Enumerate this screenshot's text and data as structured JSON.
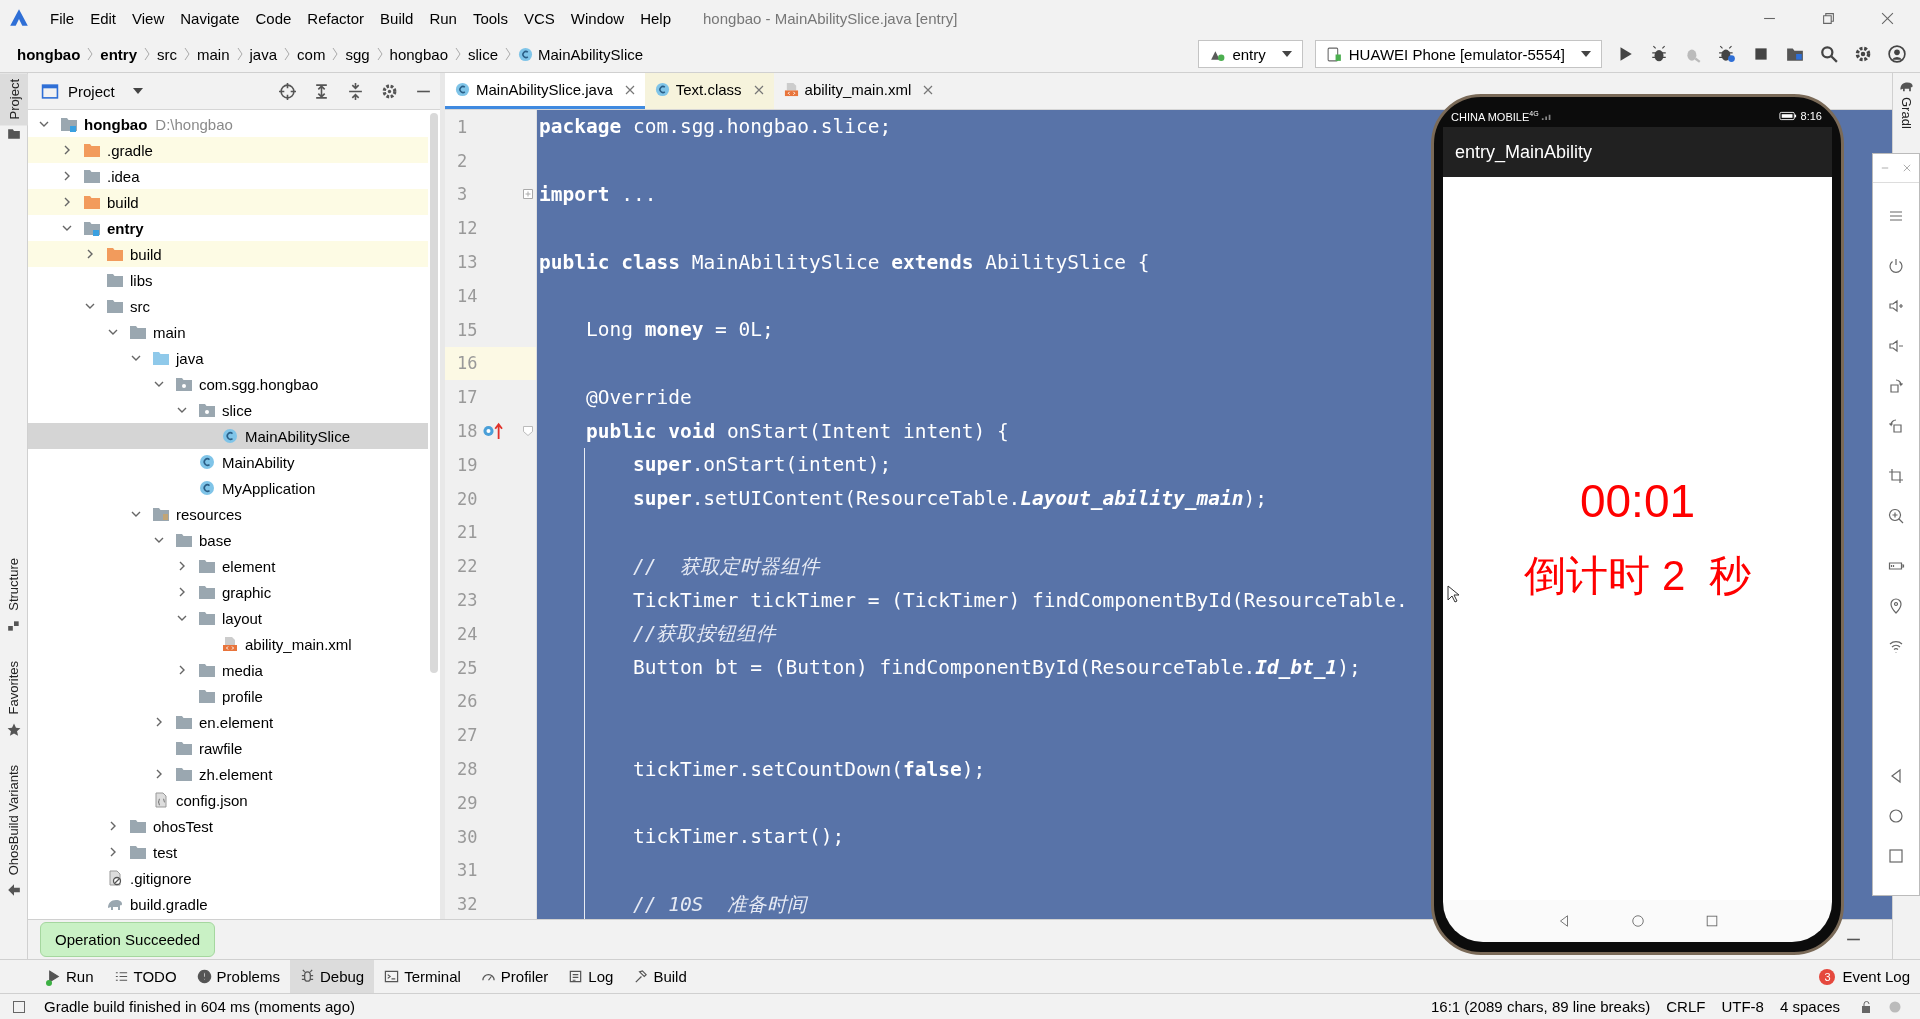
{
  "window": {
    "title": "hongbao - MainAbilitySlice.java [entry]"
  },
  "menu": [
    "File",
    "Edit",
    "View",
    "Navigate",
    "Code",
    "Refactor",
    "Build",
    "Run",
    "Tools",
    "VCS",
    "Window",
    "Help"
  ],
  "breadcrumbs": [
    {
      "label": "hongbao",
      "kind": "module"
    },
    {
      "label": "entry",
      "kind": "module"
    },
    {
      "label": "src",
      "kind": "folder"
    },
    {
      "label": "main",
      "kind": "folder"
    },
    {
      "label": "java",
      "kind": "folder"
    },
    {
      "label": "com",
      "kind": "folder"
    },
    {
      "label": "sgg",
      "kind": "folder"
    },
    {
      "label": "hongbao",
      "kind": "folder"
    },
    {
      "label": "slice",
      "kind": "folder"
    },
    {
      "label": "MainAbilitySlice",
      "kind": "class"
    }
  ],
  "run_config": "entry",
  "device": "HUAWEI Phone [emulator-5554]",
  "side_left": [
    "Project",
    "Structure",
    "Favorites",
    "OhosBuild Variants"
  ],
  "side_right": [
    "Gradl"
  ],
  "project_panel": {
    "title": "Project"
  },
  "tree": [
    {
      "name": "hongbao",
      "hint": "D:\\hongbao",
      "kind": "module",
      "expanded": true,
      "selected": false,
      "children": [
        {
          "name": ".gradle",
          "kind": "excluded",
          "expanded": false,
          "selected": false
        },
        {
          "name": ".idea",
          "kind": "folder",
          "expanded": false,
          "selected": false
        },
        {
          "name": "build",
          "kind": "excluded",
          "expanded": false,
          "selected": false
        },
        {
          "name": "entry",
          "kind": "module",
          "expanded": true,
          "selected": false,
          "children": [
            {
              "name": "build",
              "kind": "excluded",
              "expanded": false,
              "selected": false
            },
            {
              "name": "libs",
              "kind": "folder",
              "selected": false
            },
            {
              "name": "src",
              "kind": "folder",
              "expanded": true,
              "selected": false,
              "children": [
                {
                  "name": "main",
                  "kind": "folder",
                  "expanded": true,
                  "selected": false,
                  "children": [
                    {
                      "name": "java",
                      "kind": "source",
                      "expanded": true,
                      "selected": false,
                      "children": [
                        {
                          "name": "com.sgg.hongbao",
                          "kind": "package",
                          "expanded": true,
                          "selected": false,
                          "children": [
                            {
                              "name": "slice",
                              "kind": "package",
                              "expanded": true,
                              "selected": false,
                              "children": [
                                {
                                  "name": "MainAbilitySlice",
                                  "kind": "class",
                                  "selected": true
                                }
                              ]
                            },
                            {
                              "name": "MainAbility",
                              "kind": "class",
                              "selected": false
                            },
                            {
                              "name": "MyApplication",
                              "kind": "class",
                              "selected": false
                            }
                          ]
                        }
                      ]
                    },
                    {
                      "name": "resources",
                      "kind": "resources",
                      "expanded": true,
                      "selected": false,
                      "children": [
                        {
                          "name": "base",
                          "kind": "folder",
                          "expanded": true,
                          "selected": false,
                          "children": [
                            {
                              "name": "element",
                              "kind": "folder",
                              "expanded": false,
                              "selected": false
                            },
                            {
                              "name": "graphic",
                              "kind": "folder",
                              "expanded": false,
                              "selected": false
                            },
                            {
                              "name": "layout",
                              "kind": "folder",
                              "expanded": true,
                              "selected": false,
                              "children": [
                                {
                                  "name": "ability_main.xml",
                                  "kind": "xml",
                                  "selected": false
                                }
                              ]
                            },
                            {
                              "name": "media",
                              "kind": "folder",
                              "expanded": false,
                              "selected": false
                            },
                            {
                              "name": "profile",
                              "kind": "folder",
                              "selected": false
                            }
                          ]
                        },
                        {
                          "name": "en.element",
                          "kind": "folder",
                          "expanded": false,
                          "selected": false
                        },
                        {
                          "name": "rawfile",
                          "kind": "folder",
                          "selected": false
                        },
                        {
                          "name": "zh.element",
                          "kind": "folder",
                          "expanded": false,
                          "selected": false
                        }
                      ]
                    },
                    {
                      "name": "config.json",
                      "kind": "json",
                      "selected": false
                    }
                  ]
                },
                {
                  "name": "ohosTest",
                  "kind": "folder",
                  "expanded": false,
                  "selected": false
                },
                {
                  "name": "test",
                  "kind": "folder",
                  "expanded": false,
                  "selected": false
                }
              ]
            },
            {
              "name": ".gitignore",
              "kind": "gitignore",
              "selected": false
            },
            {
              "name": "build.gradle",
              "kind": "gradle",
              "selected": false
            }
          ]
        }
      ]
    }
  ],
  "tabs": [
    {
      "label": "MainAbilitySlice.java",
      "kind": "java",
      "selected": true
    },
    {
      "label": "Text.class",
      "kind": "class",
      "selected": false
    },
    {
      "label": "ability_main.xml",
      "kind": "xml",
      "selected": false
    }
  ],
  "code": [
    {
      "n": "1",
      "text": "**package** com.sgg.hongbao.slice;",
      "kind": "code",
      "current": false,
      "override": false
    },
    {
      "n": "2",
      "kind": "code",
      "current": false,
      "override": false
    },
    {
      "n": "3",
      "text": "**import** ...",
      "kind": "code",
      "current": false,
      "override": false,
      "collapsed": true
    },
    {
      "n": "12",
      "kind": "code",
      "current": false,
      "override": false
    },
    {
      "n": "13",
      "text": "**public** **class** MainAbilitySlice **extends** AbilitySlice {",
      "kind": "code",
      "current": false,
      "override": false
    },
    {
      "n": "14",
      "kind": "code",
      "current": false,
      "override": false
    },
    {
      "n": "15",
      "text": "    Long **money** = 0L;",
      "kind": "code",
      "current": false,
      "override": false
    },
    {
      "n": "16",
      "kind": "code",
      "current": true,
      "override": false
    },
    {
      "n": "17",
      "text": "    @Override",
      "kind": "code",
      "current": false,
      "override": false
    },
    {
      "n": "18",
      "text": "    **public** **void** onStart(Intent intent) {",
      "kind": "code",
      "current": false,
      "override": true,
      "collapsed": false
    },
    {
      "n": "19",
      "text": "        **super**.onStart(intent);",
      "kind": "code",
      "current": false,
      "override": false
    },
    {
      "n": "20",
      "text": "        **super**.setUIContent(ResourceTable.*Layout_ability_main*);",
      "kind": "code",
      "current": false,
      "override": false
    },
    {
      "n": "21",
      "kind": "code",
      "current": false,
      "override": false
    },
    {
      "n": "22",
      "text": "        //  获取定时器组件",
      "kind": "comment",
      "current": false,
      "override": false
    },
    {
      "n": "23",
      "text": "        TickTimer tickTimer = (TickTimer) findComponentById(ResourceTable.",
      "kind": "code",
      "current": false,
      "override": false
    },
    {
      "n": "24",
      "text": "        //获取按钮组件",
      "kind": "comment",
      "current": false,
      "override": false
    },
    {
      "n": "25",
      "text": "        Button bt = (Button) findComponentById(ResourceTable.*Id_bt_1*);",
      "kind": "code",
      "current": false,
      "override": false
    },
    {
      "n": "26",
      "kind": "code",
      "current": false,
      "override": false
    },
    {
      "n": "27",
      "kind": "code",
      "current": false,
      "override": false
    },
    {
      "n": "28",
      "text": "        tickTimer.setCountDown(**false**);",
      "kind": "code",
      "current": false,
      "override": false
    },
    {
      "n": "29",
      "kind": "code",
      "current": false,
      "override": false
    },
    {
      "n": "30",
      "text": "        tickTimer.start();",
      "kind": "code",
      "current": false,
      "override": false
    },
    {
      "n": "31",
      "kind": "code",
      "current": false,
      "override": false
    },
    {
      "n": "32",
      "text": "        // 10S  准备时间",
      "kind": "comment",
      "current": false,
      "override": false
    }
  ],
  "phone": {
    "carrier": "CHINA MOBILE",
    "network": "4G",
    "time": "8:16",
    "app_title": "entry_MainAbility",
    "timer": "00:01",
    "countdown": "倒计时 2  秒"
  },
  "notification": "Operation Succeeded",
  "tool_tabs": [
    {
      "label": "Run",
      "selected": false,
      "running": true
    },
    {
      "label": "TODO",
      "selected": false,
      "running": false
    },
    {
      "label": "Problems",
      "selected": false,
      "running": false
    },
    {
      "label": "Debug",
      "selected": true,
      "running": false
    },
    {
      "label": "Terminal",
      "selected": false,
      "running": false
    },
    {
      "label": "Profiler",
      "selected": false,
      "running": false
    },
    {
      "label": "Log",
      "selected": false,
      "running": false
    },
    {
      "label": "Build",
      "selected": false,
      "running": false
    }
  ],
  "event_log": {
    "label": "Event Log",
    "count": "3"
  },
  "status_bar": {
    "message": "Gradle build finished in 604 ms (moments ago)",
    "position": "16:1 (2089 chars, 89 line breaks)",
    "line_separator": "CRLF",
    "encoding": "UTF-8",
    "indent": "4 spaces"
  }
}
